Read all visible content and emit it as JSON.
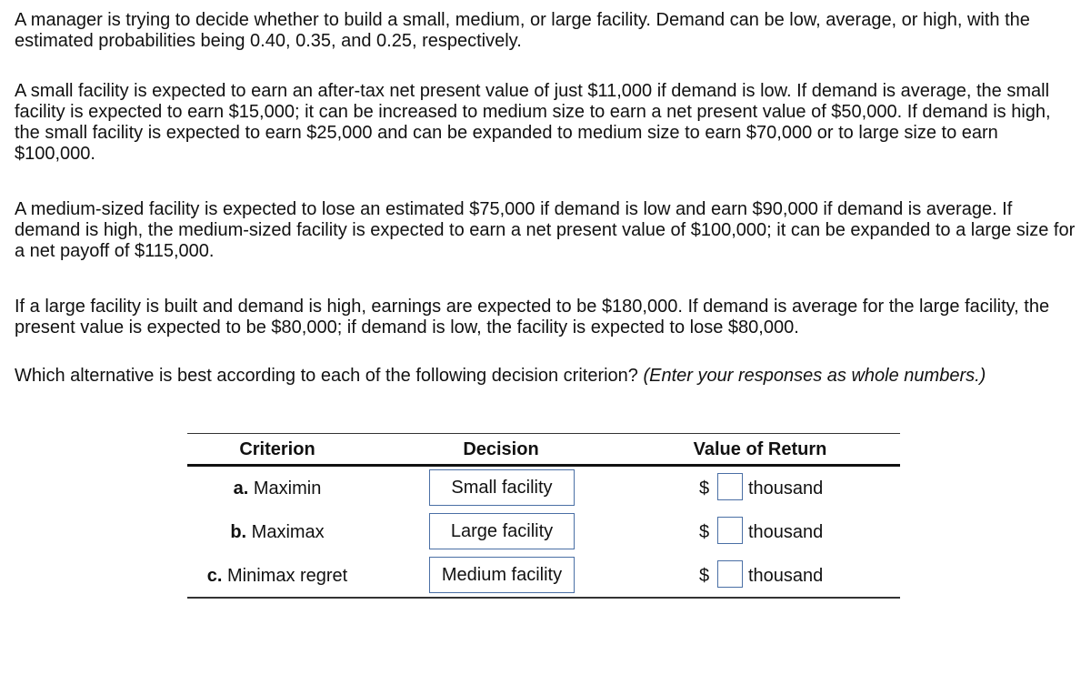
{
  "problem": {
    "paragraph1": "A manager is trying to decide whether to build a small, medium, or large facility. Demand can be low, average, or high, with the estimated probabilities being 0.40, 0.35, and 0.25, respectively.",
    "paragraph2": "A small facility is expected to earn an after-tax net present value of just $11,000 if demand is low. If demand is average, the small facility is expected to earn $15,000; it can be increased to medium size to earn a net present value of $50,000. If demand is high, the small facility is expected to earn $25,000 and can be expanded to medium size to earn $70,000 or to large size to earn $100,000.",
    "paragraph3": "A medium-sized facility is expected to lose an estimated $75,000 if demand is low and earn $90,000 if demand is average. If demand is high, the medium-sized facility is expected to earn a net present value of $100,000; it can be expanded to a large size for a net payoff of $115,000.",
    "paragraph4": "If a large facility is built and demand is high, earnings are expected to be $180,000. If demand is average for the large facility, the present value is expected to be $80,000; if demand is low, the facility is expected to lose $80,000.",
    "question": "Which alternative is best according to each of the following decision criterion?",
    "instruction": "(Enter your responses as whole numbers.)"
  },
  "table": {
    "headers": [
      "Criterion",
      "Decision",
      "Value of Return"
    ],
    "rows": [
      {
        "letter": "a.",
        "criterion": "Maximin",
        "decision": "Small facility",
        "currency": "$",
        "value": "",
        "unit": "thousand"
      },
      {
        "letter": "b.",
        "criterion": "Maximax",
        "decision": "Large facility",
        "currency": "$",
        "value": "",
        "unit": "thousand"
      },
      {
        "letter": "c.",
        "criterion": "Minimax regret",
        "decision": "Medium facility",
        "currency": "$",
        "value": "",
        "unit": "thousand"
      }
    ]
  }
}
